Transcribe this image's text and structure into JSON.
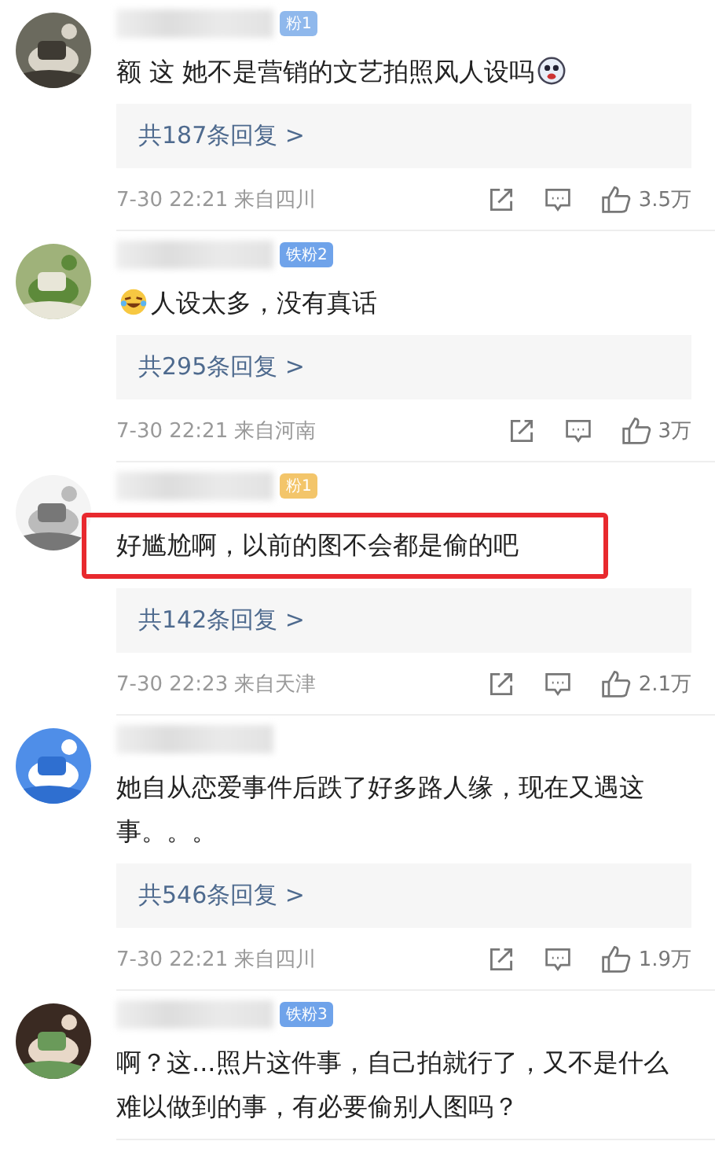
{
  "comments": [
    {
      "badge": {
        "text": "粉1",
        "color": "#8fb8ec"
      },
      "emoji_before": false,
      "emoji_after": true,
      "text": "额 这 她不是营销的文艺拍照风人设吗",
      "replies": "共187条回复 >",
      "time": "7-30 22:21 来自四川",
      "likes": "3.5万",
      "highlighted": false
    },
    {
      "badge": {
        "text": "铁粉2",
        "color": "#6fa3ea"
      },
      "emoji_before": true,
      "emoji_after": false,
      "text": "人设太多，没有真话",
      "replies": "共295条回复 >",
      "time": "7-30 22:21 来自河南",
      "likes": "3万",
      "highlighted": false
    },
    {
      "badge": {
        "text": "粉1",
        "color": "#f3c56a"
      },
      "emoji_before": false,
      "emoji_after": false,
      "text": "好尴尬啊，以前的图不会都是偷的吧",
      "replies": "共142条回复 >",
      "time": "7-30 22:23 来自天津",
      "likes": "2.1万",
      "highlighted": true
    },
    {
      "emoji_before": false,
      "emoji_after": false,
      "text": "她自从恋爱事件后跌了好多路人缘，现在又遇这事。。。",
      "replies": "共546条回复 >",
      "time": "7-30 22:21 来自四川",
      "likes": "1.9万",
      "highlighted": false
    },
    {
      "badge": {
        "text": "铁粉3",
        "color": "#6fa3ea"
      },
      "emoji_before": false,
      "emoji_after": false,
      "text": "啊？这...照片这件事，自己拍就行了，又不是什么难以做到的事，有必要偷别人图吗？",
      "highlighted": false
    }
  ]
}
